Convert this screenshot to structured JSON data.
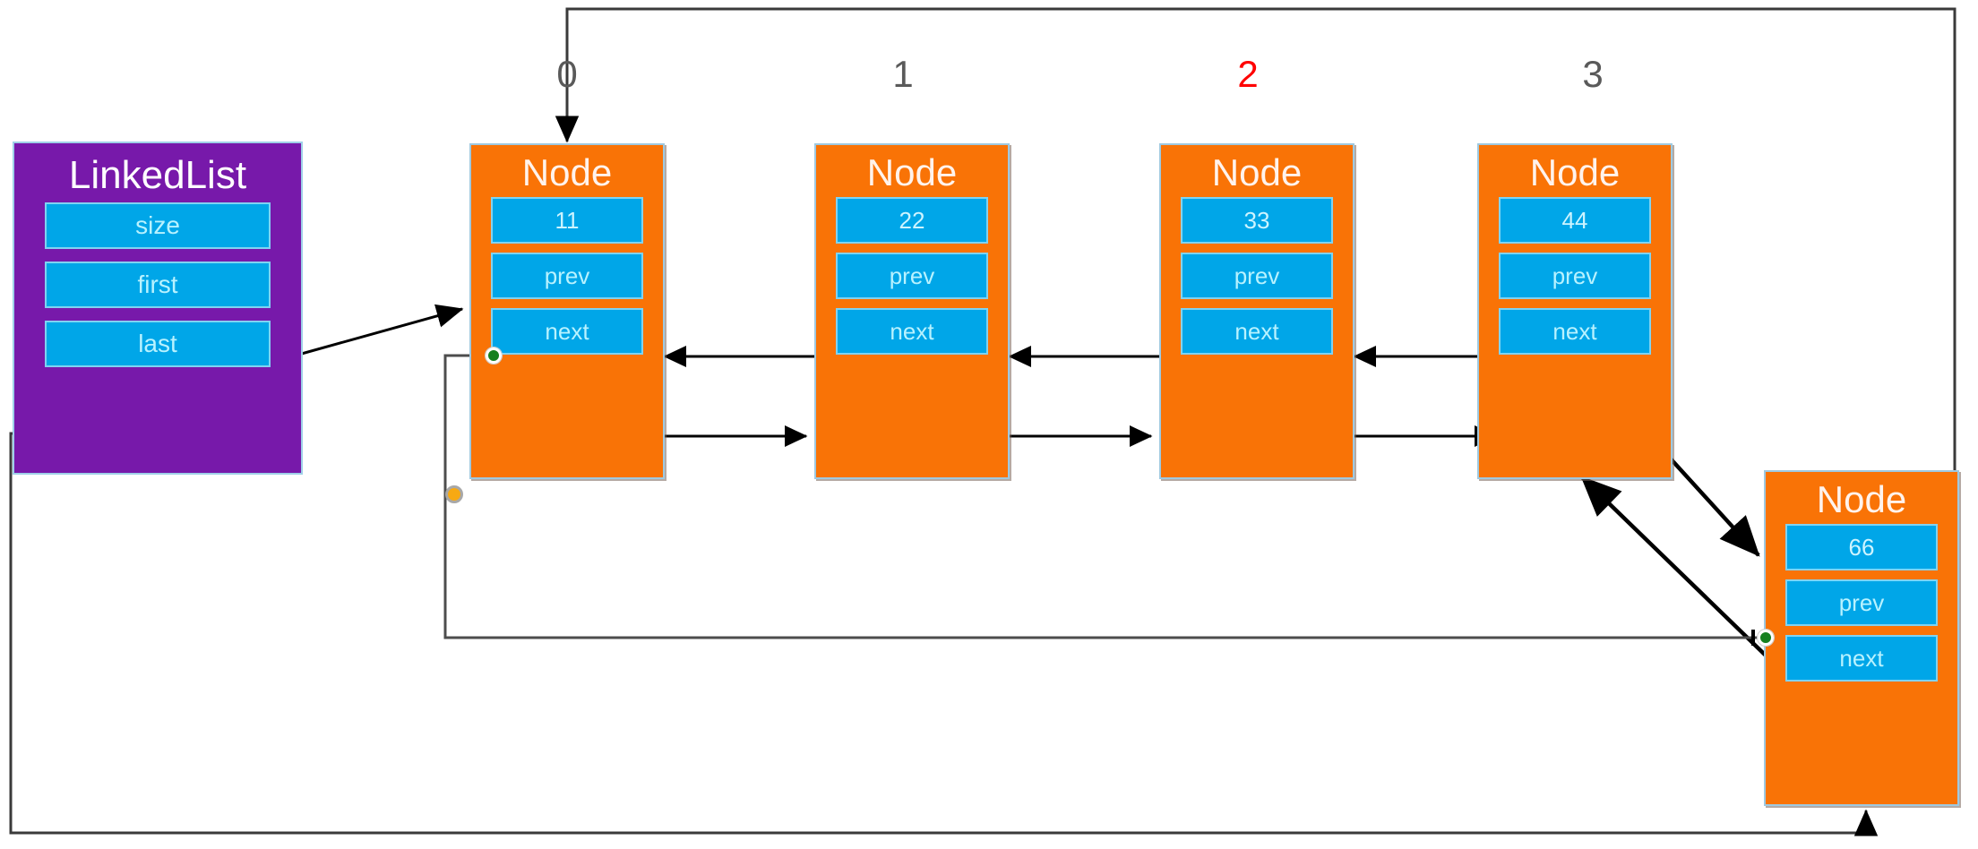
{
  "diagram": {
    "title": "Doubly linked list structure",
    "colors": {
      "node_fill": "#F97306",
      "field_fill": "#00A6E8",
      "list_fill": "#7719AA",
      "index_normal": "#5A5A5A",
      "index_highlight": "#FF0000",
      "dot_green": "#157F1F",
      "dot_orange": "#F7A913",
      "connector": "#4d4d4d",
      "arrow": "#000000"
    },
    "background": "#FFFFFF"
  },
  "list_object": {
    "title": "LinkedList",
    "fields": [
      {
        "label": "size"
      },
      {
        "label": "first"
      },
      {
        "label": "last"
      }
    ]
  },
  "index_labels": [
    {
      "text": "0",
      "highlight": false
    },
    {
      "text": "1",
      "highlight": false
    },
    {
      "text": "2",
      "highlight": true
    },
    {
      "text": "3",
      "highlight": false
    }
  ],
  "nodes": [
    {
      "title": "Node",
      "value": "11",
      "prev_label": "prev",
      "next_label": "next"
    },
    {
      "title": "Node",
      "value": "22",
      "prev_label": "prev",
      "next_label": "next"
    },
    {
      "title": "Node",
      "value": "33",
      "prev_label": "prev",
      "next_label": "next"
    },
    {
      "title": "Node",
      "value": "44",
      "prev_label": "prev",
      "next_label": "next"
    },
    {
      "title": "Node",
      "value": "66",
      "prev_label": "prev",
      "next_label": "next"
    }
  ],
  "markers": {
    "green_dot_node0_prev": "green-endpoint",
    "green_dot_node66": "green-endpoint",
    "orange_waypoint": "orange-waypoint"
  }
}
